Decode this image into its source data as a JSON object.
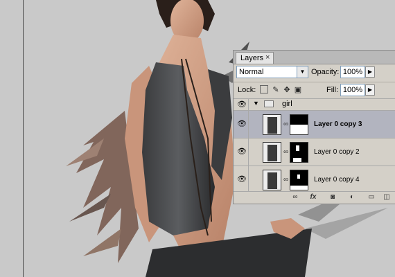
{
  "panel": {
    "tab_label": "Layers",
    "tab_close": "×",
    "blend_mode": "Normal",
    "opacity_label": "Opacity:",
    "opacity_value": "100%",
    "lock_label": "Lock:",
    "fill_label": "Fill:",
    "fill_value": "100%"
  },
  "group": {
    "name": "girl",
    "expanded": true
  },
  "layers": [
    {
      "name": "Layer 0 copy 3",
      "selected": true,
      "visible": true
    },
    {
      "name": "Layer 0 copy 2",
      "selected": false,
      "visible": true
    },
    {
      "name": "Layer 0 copy 4",
      "selected": false,
      "visible": true
    }
  ],
  "icons": {
    "eye": "eye-icon",
    "folder": "folder-icon",
    "chain": "chain-link-icon",
    "lock_transparent": "lock-transparent-pixels-icon",
    "lock_image": "lock-image-pixels-icon",
    "lock_position": "lock-position-icon",
    "lock_all": "lock-all-icon",
    "bottom": [
      "link-layers-icon",
      "fx-icon",
      "add-mask-icon",
      "adjustment-layer-icon",
      "new-group-icon",
      "new-layer-icon"
    ]
  },
  "colors": {
    "panel_bg": "#d4d0c8",
    "selected_row": "#b2b4bf",
    "canvas_bg": "#c9c9c9"
  }
}
